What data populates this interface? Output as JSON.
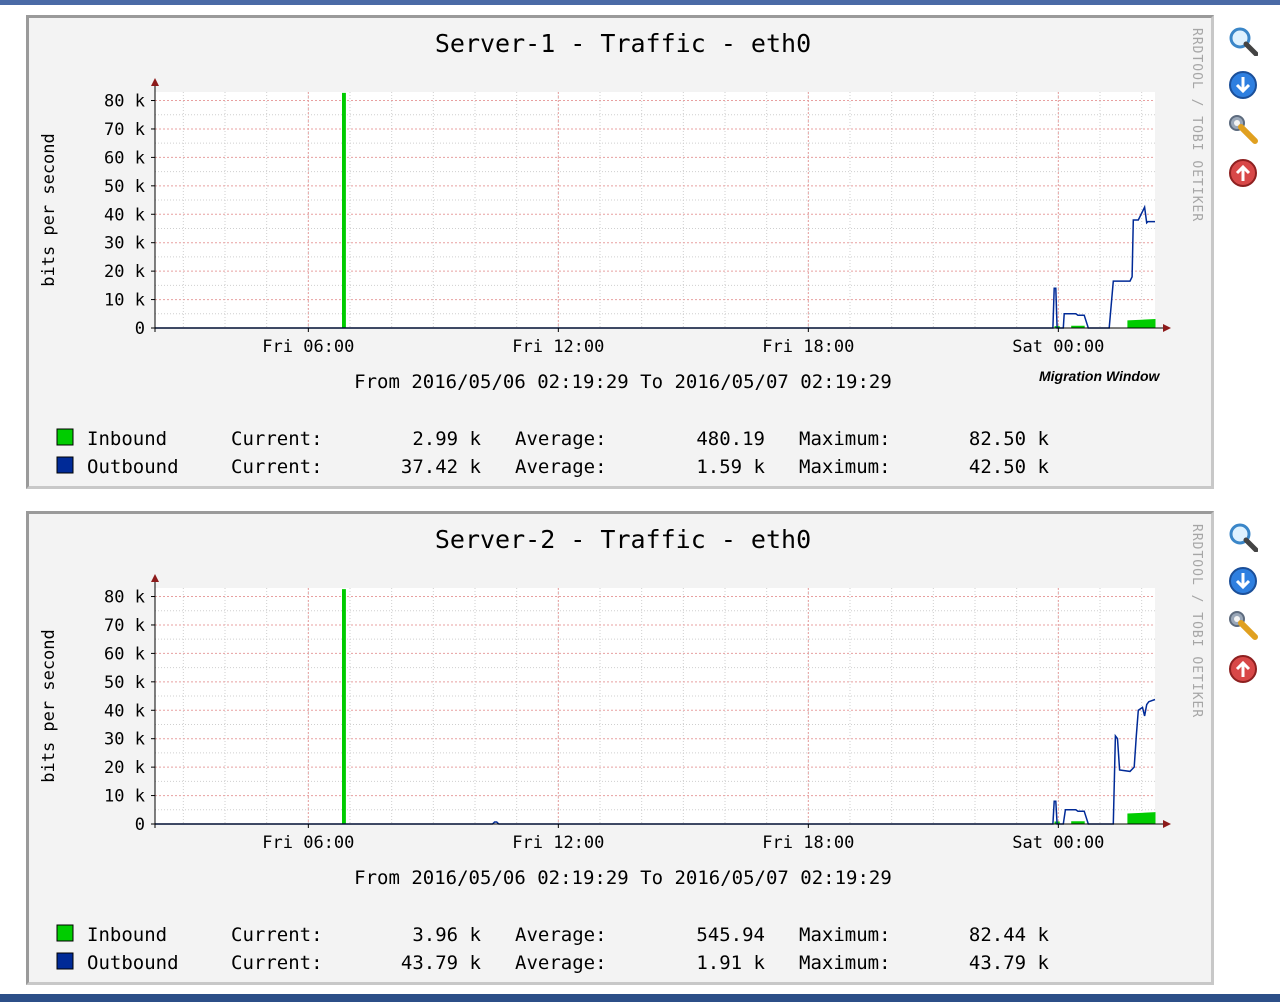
{
  "page": {
    "colors": {
      "inbound": "#00cc00",
      "outbound": "#002a97",
      "gridMajor": "#e8a0a0",
      "gridMinor": "#cfcfcf",
      "axis": "#8c1a1a",
      "frame": "#9a9a9a",
      "plotBackground": "#ffffff",
      "canvasBackground": "#f3f3f3"
    },
    "tool_icons": [
      "zoom-icon",
      "download-icon",
      "settings-wrench-icon",
      "upload-icon"
    ]
  },
  "graphs": [
    {
      "id": "graph-1",
      "watermark": "RRDTOOL / TOBI OETIKER",
      "annotation": "Migration Window",
      "range_text": "From 2016/05/06 02:19:29 To 2016/05/07 02:19:29",
      "legend": [
        {
          "label": "Inbound",
          "current_label": "Current:",
          "current": "2.99 k",
          "average_label": "Average:",
          "average": "480.19",
          "maximum_label": "Maximum:",
          "maximum": "82.50 k"
        },
        {
          "label": "Outbound",
          "current_label": "Current:",
          "current": "37.42 k",
          "average_label": "Average:",
          "average": "1.59 k",
          "maximum_label": "Maximum:",
          "maximum": "42.50 k"
        }
      ],
      "chart_data": {
        "type": "area",
        "title": "Server-1 - Traffic - eth0",
        "ylabel": "bits per second",
        "xlabel": "",
        "x_unit": "hours since window start (2016/05/06 02:19:29)",
        "xlim": [
          0,
          24
        ],
        "ylim": [
          0,
          83000
        ],
        "yticks": [
          0,
          10000,
          20000,
          30000,
          40000,
          50000,
          60000,
          70000,
          80000
        ],
        "ytick_labels": [
          "0",
          "10 k",
          "20 k",
          "30 k",
          "40 k",
          "50 k",
          "60 k",
          "70 k",
          "80 k"
        ],
        "xticks": [
          3.68,
          9.68,
          15.68,
          21.68
        ],
        "xtick_labels": [
          "Fri 06:00",
          "Fri 12:00",
          "Fri 18:00",
          "Sat 00:00"
        ],
        "grid": true,
        "series": [
          {
            "name": "Inbound",
            "style": "area",
            "x": [
              0,
              4.5,
              4.5,
              4.57,
              4.57,
              21.6,
              21.6,
              21.7,
              21.7,
              22.0,
              22.0,
              22.3,
              22.3,
              23.35,
              23.35,
              24.0
            ],
            "values": [
              0,
              0,
              82500,
              82500,
              0,
              0,
              500,
              500,
              0,
              0,
              600,
              600,
              0,
              0,
              2500,
              2990
            ]
          },
          {
            "name": "Outbound",
            "style": "line",
            "x": [
              0,
              21.55,
              21.58,
              21.62,
              21.65,
              21.7,
              21.8,
              21.82,
              21.85,
              22.1,
              22.15,
              22.3,
              22.4,
              22.9,
              23.0,
              23.1,
              23.4,
              23.45,
              23.48,
              23.6,
              23.75,
              23.8,
              23.83,
              24.0
            ],
            "values": [
              0,
              0,
              14000,
              14000,
              0,
              0,
              0,
              5000,
              5000,
              5000,
              4500,
              4500,
              0,
              0,
              16500,
              16500,
              16500,
              18000,
              38000,
              38000,
              42500,
              37000,
              37420,
              37420
            ]
          }
        ]
      }
    },
    {
      "id": "graph-2",
      "watermark": "RRDTOOL / TOBI OETIKER",
      "range_text": "From 2016/05/06 02:19:29 To 2016/05/07 02:19:29",
      "legend": [
        {
          "label": "Inbound",
          "current_label": "Current:",
          "current": "3.96 k",
          "average_label": "Average:",
          "average": "545.94",
          "maximum_label": "Maximum:",
          "maximum": "82.44 k"
        },
        {
          "label": "Outbound",
          "current_label": "Current:",
          "current": "43.79 k",
          "average_label": "Average:",
          "average": "1.91 k",
          "maximum_label": "Maximum:",
          "maximum": "43.79 k"
        }
      ],
      "chart_data": {
        "type": "area",
        "title": "Server-2 - Traffic - eth0",
        "ylabel": "bits per second",
        "xlabel": "",
        "x_unit": "hours since window start (2016/05/06 02:19:29)",
        "xlim": [
          0,
          24
        ],
        "ylim": [
          0,
          83000
        ],
        "yticks": [
          0,
          10000,
          20000,
          30000,
          40000,
          50000,
          60000,
          70000,
          80000
        ],
        "ytick_labels": [
          "0",
          "10 k",
          "20 k",
          "30 k",
          "40 k",
          "50 k",
          "60 k",
          "70 k",
          "80 k"
        ],
        "xticks": [
          3.68,
          9.68,
          15.68,
          21.68
        ],
        "xtick_labels": [
          "Fri 06:00",
          "Fri 12:00",
          "Fri 18:00",
          "Sat 00:00"
        ],
        "grid": true,
        "series": [
          {
            "name": "Inbound",
            "style": "area",
            "x": [
              0,
              4.5,
              4.5,
              4.57,
              4.57,
              21.6,
              21.6,
              21.7,
              21.7,
              22.0,
              22.0,
              22.3,
              22.3,
              23.35,
              23.35,
              24.0
            ],
            "values": [
              0,
              0,
              82440,
              82440,
              0,
              0,
              700,
              700,
              0,
              0,
              800,
              800,
              0,
              0,
              3500,
              3960
            ]
          },
          {
            "name": "Outbound",
            "style": "line",
            "x": [
              0,
              8.1,
              8.15,
              8.2,
              8.25,
              21.55,
              21.58,
              21.62,
              21.65,
              21.75,
              21.8,
              21.85,
              21.9,
              22.1,
              22.15,
              22.3,
              22.4,
              23.0,
              23.05,
              23.1,
              23.15,
              23.4,
              23.5,
              23.55,
              23.6,
              23.7,
              23.75,
              23.8,
              23.85,
              24.0
            ],
            "values": [
              0,
              0,
              700,
              700,
              0,
              0,
              8000,
              8000,
              0,
              0,
              0,
              5000,
              5000,
              5000,
              4500,
              4500,
              0,
              0,
              31000,
              30000,
              19000,
              18500,
              20000,
              31000,
              40000,
              41000,
              38000,
              42000,
              43000,
              43790
            ]
          }
        ]
      }
    }
  ]
}
